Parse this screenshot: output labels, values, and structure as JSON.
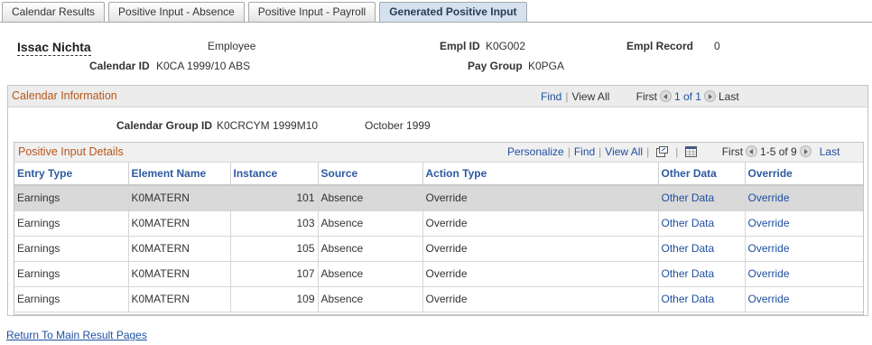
{
  "tabs": [
    {
      "label": "Calendar Results",
      "active": false
    },
    {
      "label": "Positive Input - Absence",
      "active": false
    },
    {
      "label": "Positive Input - Payroll",
      "active": false
    },
    {
      "label": "Generated Positive Input",
      "active": true
    }
  ],
  "header": {
    "employee_name": "Issac Nichta",
    "employee_label": "Employee",
    "empl_id_label": "Empl ID",
    "empl_id_value": "K0G002",
    "empl_record_label": "Empl Record",
    "empl_record_value": "0",
    "calendar_id_label": "Calendar ID",
    "calendar_id_value": "K0CA 1999/10 ABS",
    "pay_group_label": "Pay Group",
    "pay_group_value": "K0PGA"
  },
  "calendar_info": {
    "title": "Calendar Information",
    "find": "Find",
    "view_all": "View All",
    "first": "First",
    "pager": "1 of 1",
    "last": "Last",
    "group_id_label": "Calendar Group ID",
    "group_id_value": "K0CRCYM 1999M10",
    "period": "October 1999"
  },
  "positive_input": {
    "title": "Positive Input Details",
    "personalize": "Personalize",
    "find": "Find",
    "view_all": "View All",
    "first": "First",
    "pager": "1-5 of 9",
    "last": "Last",
    "columns": [
      "Entry Type",
      "Element Name",
      "Instance",
      "Source",
      "Action Type",
      "Other Data",
      "Override"
    ],
    "rows": [
      {
        "entry_type": "Earnings",
        "element": "K0MATERN",
        "instance": "101",
        "source": "Absence",
        "action": "Override",
        "other_data": "Other Data",
        "override": "Override"
      },
      {
        "entry_type": "Earnings",
        "element": "K0MATERN",
        "instance": "103",
        "source": "Absence",
        "action": "Override",
        "other_data": "Other Data",
        "override": "Override"
      },
      {
        "entry_type": "Earnings",
        "element": "K0MATERN",
        "instance": "105",
        "source": "Absence",
        "action": "Override",
        "other_data": "Other Data",
        "override": "Override"
      },
      {
        "entry_type": "Earnings",
        "element": "K0MATERN",
        "instance": "107",
        "source": "Absence",
        "action": "Override",
        "other_data": "Other Data",
        "override": "Override"
      },
      {
        "entry_type": "Earnings",
        "element": "K0MATERN",
        "instance": "109",
        "source": "Absence",
        "action": "Override",
        "other_data": "Other Data",
        "override": "Override"
      }
    ]
  },
  "footer": {
    "return_link": "Return To Main Result Pages"
  },
  "colors": {
    "accent_title": "#b7561a",
    "link": "#1f4fa0",
    "header_text": "#2d5aa0",
    "selected_row": "#d9d9d9"
  }
}
